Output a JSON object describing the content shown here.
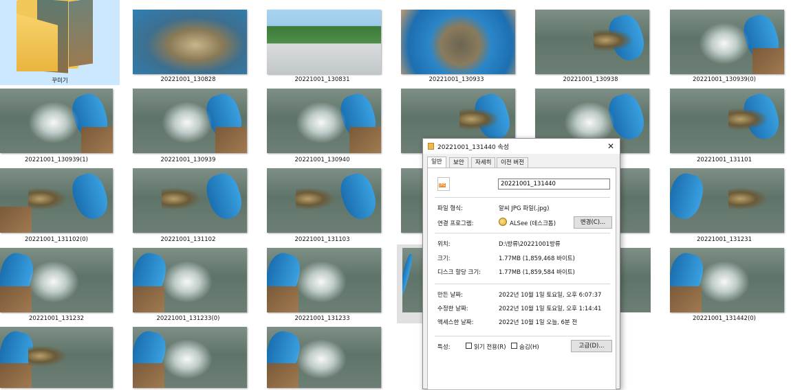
{
  "folder": {
    "label": "꾸미기"
  },
  "files": [
    "20221001_130828",
    "20221001_130831",
    "20221001_130933",
    "20221001_130938",
    "20221001_130939(0)",
    "20221001_130939(1)",
    "20221001_130939",
    "20221001_130940",
    "20221001_131101",
    "20221001_131102(0)",
    "20221001_131102",
    "20221001_131103",
    "20221001_131231",
    "20221001_131232",
    "20221001_131233(0)",
    "20221001_131233",
    "20221001_131442(0)",
    "20221001_131440"
  ],
  "dialog": {
    "title": "20221001_131440 속성",
    "close": "✕",
    "tabs": [
      "일반",
      "보안",
      "자세히",
      "이전 버전"
    ],
    "file_icon_text": "JPG",
    "filename": "20221001_131440",
    "file_type_label": "파일 형식:",
    "file_type": "알씨 JPG 파일(.jpg)",
    "opens_with_label": "연결 프로그램:",
    "opens_with": "ALSee (데스크톱)",
    "change_button": "변경(C)...",
    "location_label": "위치:",
    "location": "D:\\방류\\20221001방류",
    "size_label": "크기:",
    "size": "1.77MB (1,859,468 바이트)",
    "disk_size_label": "디스크 할당 크기:",
    "disk_size": "1.77MB (1,859,584 바이트)",
    "created_label": "만든 날짜:",
    "created": "2022년 10월 1일 토요일, 오후 6:07:37",
    "modified_label": "수정한 날짜:",
    "modified": "2022년 10월 1일 토요일, 오후 1:14:41",
    "accessed_label": "액세스한 날짜:",
    "accessed": "2022년 10월 1일 오늘, 6분 전",
    "attributes_label": "특성:",
    "readonly_label": "읽기 전용(R)",
    "hidden_label": "숨김(H)",
    "advanced_button": "고급(D)..."
  }
}
